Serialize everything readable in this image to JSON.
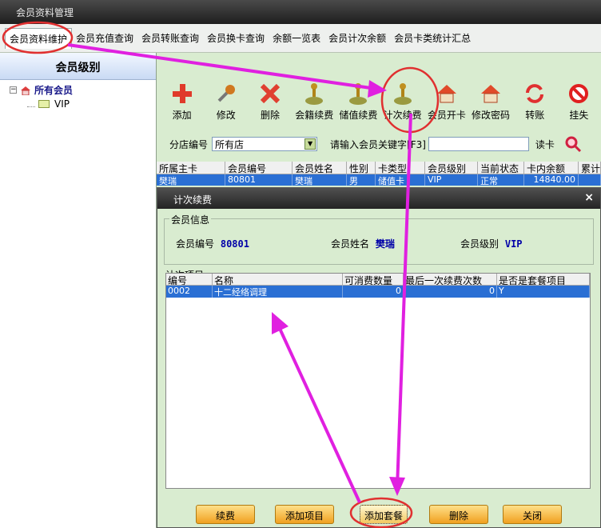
{
  "window": {
    "title": "会员资料管理"
  },
  "tabs": [
    "会员资料维护",
    "会员充值查询",
    "会员转账查询",
    "会员换卡查询",
    "余额一览表",
    "会员计次余额",
    "会员卡类统计汇总"
  ],
  "left_panel": {
    "header": "会员级别",
    "root": {
      "label": "所有会员",
      "expander": "−"
    },
    "children": [
      "VIP"
    ]
  },
  "toolbar": [
    "添加",
    "修改",
    "删除",
    "会籍续费",
    "储值续费",
    "计次续费",
    "会员开卡",
    "修改密码",
    "转账",
    "挂失"
  ],
  "filter": {
    "branch_label": "分店编号",
    "branch_value": "所有店",
    "keyword_label": "请输入会员关键字[F3]",
    "keyword_value": "",
    "read_card_label": "读卡"
  },
  "member_grid": {
    "columns": [
      "所属主卡",
      "会员编号",
      "会员姓名",
      "性别",
      "卡类型",
      "会员级别",
      "当前状态",
      "卡内余额",
      "累计"
    ],
    "row": [
      "樊瑞",
      "80801",
      "樊瑞",
      "男",
      "储值卡",
      "VIP",
      "正常",
      "14840.00",
      ""
    ]
  },
  "dialog": {
    "title": "计次续费",
    "close": "×",
    "member_info": {
      "group_label": "会员信息",
      "id_label": "会员编号",
      "id_value": "80801",
      "name_label": "会员姓名",
      "name_value": "樊瑞",
      "level_label": "会员级别",
      "level_value": "VIP"
    },
    "items": {
      "group_label": "计次项目",
      "columns": [
        "编号",
        "名称",
        "可消费数量",
        "最后一次续费次数",
        "是否是套餐项目"
      ],
      "rows": [
        [
          "0002",
          "十二经络调理",
          "0",
          "0",
          "Y"
        ]
      ]
    },
    "buttons": [
      "续费",
      "添加项目",
      "添加套餐",
      "删除",
      "关闭"
    ]
  },
  "colors": {
    "annotation": "#e020e0",
    "highlight_circle": "#e03030",
    "selection": "#2a6fd4"
  }
}
